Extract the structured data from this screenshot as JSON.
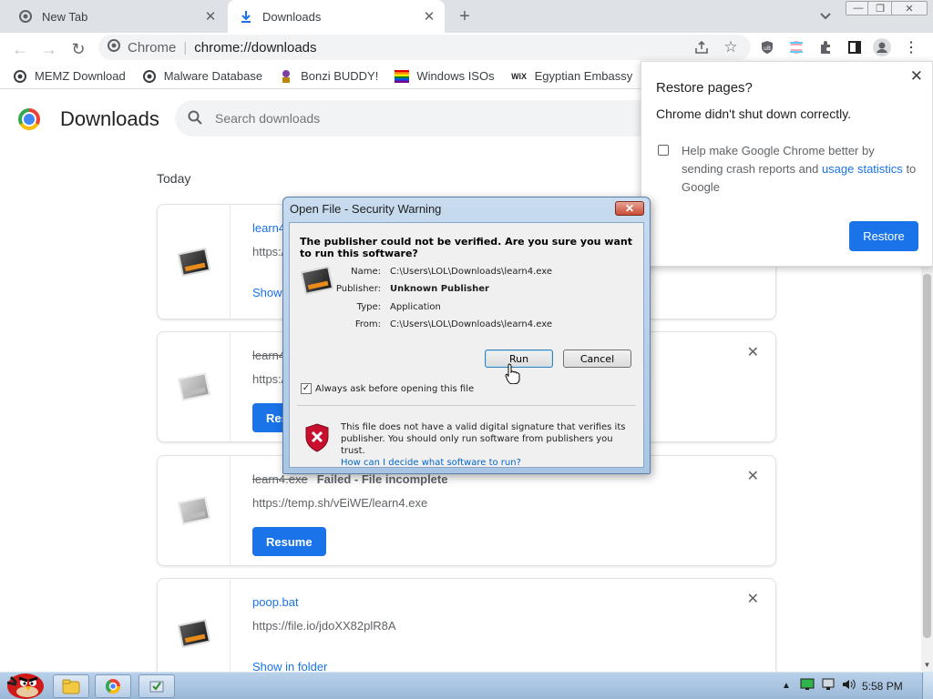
{
  "tabs": [
    {
      "label": "New Tab"
    },
    {
      "label": "Downloads"
    }
  ],
  "omnibox": {
    "site": "Chrome",
    "url": "chrome://downloads"
  },
  "bookmarks": [
    {
      "label": "MEMZ Download"
    },
    {
      "label": "Malware Database"
    },
    {
      "label": "Bonzi BUDDY!"
    },
    {
      "label": "Windows ISOs"
    },
    {
      "label": "Egyptian Embassy"
    }
  ],
  "page": {
    "title": "Downloads",
    "search_placeholder": "Search downloads",
    "section": "Today"
  },
  "downloads": [
    {
      "name": "learn4.exe",
      "url": "https://temp.sh/vEiWE/learn4.exe",
      "action": "Show in folder"
    },
    {
      "name": "learn4.exe",
      "url": "https://temp.sh/vEiWE/learn4.exe",
      "action": "Resume"
    },
    {
      "name": "learn4.exe",
      "status": "Failed - File incomplete",
      "url": "https://temp.sh/vEiWE/learn4.exe",
      "action": "Resume"
    },
    {
      "name": "poop.bat",
      "url": "https://file.io/jdoXX82plR8A",
      "action": "Show in folder"
    }
  ],
  "restore_bubble": {
    "title": "Restore pages?",
    "message": "Chrome didn't shut down correctly.",
    "help_text": "Help make Google Chrome better by sending crash reports and",
    "help_link": "usage statistics",
    "help_suffix": "to Google",
    "button": "Restore"
  },
  "dialog": {
    "title": "Open File - Security Warning",
    "heading": "The publisher could not be verified.  Are you sure you want to run this software?",
    "fields": [
      {
        "label": "Name:",
        "value": "C:\\Users\\LOL\\Downloads\\learn4.exe"
      },
      {
        "label": "Publisher:",
        "value": "Unknown Publisher"
      },
      {
        "label": "Type:",
        "value": "Application"
      },
      {
        "label": "From:",
        "value": "C:\\Users\\LOL\\Downloads\\learn4.exe"
      }
    ],
    "run_label": "Run",
    "cancel_label": "Cancel",
    "always_ask": "Always ask before opening this file",
    "warning": "This file does not have a valid digital signature that verifies its publisher.  You should only run software from publishers you trust.",
    "warning_link": "How can I decide what software to run?"
  },
  "taskbar": {
    "time": "5:58 PM"
  },
  "colors": {
    "accent": "#1a73e8",
    "tabstrip": "#dee1e6",
    "taskbar": "#b9d1ea"
  }
}
